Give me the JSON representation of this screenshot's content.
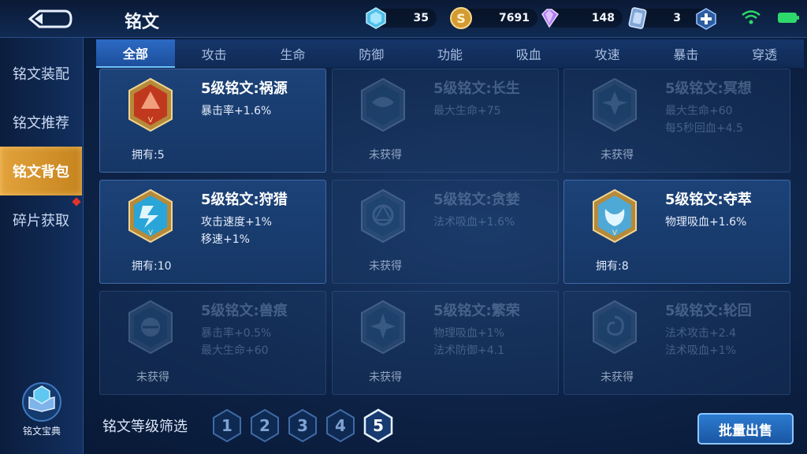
{
  "header": {
    "title": "铭文",
    "back_icon": "back-arrow-icon",
    "resources": [
      {
        "icon": "crystal-icon",
        "value": "35"
      },
      {
        "icon": "gold-coin-icon",
        "value": "7691"
      },
      {
        "icon": "purple-gem-icon",
        "value": "148"
      },
      {
        "icon": "card-ticket-icon",
        "value": "3"
      }
    ]
  },
  "sidebar": {
    "items": [
      {
        "label": "铭文装配"
      },
      {
        "label": "铭文推荐"
      },
      {
        "label": "铭文背包",
        "active": true
      },
      {
        "label": "碎片获取"
      }
    ],
    "codex_label": "铭文宝典"
  },
  "tabs": [
    "全部",
    "攻击",
    "生命",
    "防御",
    "功能",
    "吸血",
    "攻速",
    "暴击",
    "穿透"
  ],
  "cards": [
    {
      "name": "5级铭文:祸源",
      "attrs": [
        "暴击率+1.6%"
      ],
      "owned": "拥有:5",
      "locked": false,
      "color": "#c0391f"
    },
    {
      "name": "5级铭文:长生",
      "attrs": [
        "最大生命+75"
      ],
      "owned": "未获得",
      "locked": true,
      "color": "#2c5f8a"
    },
    {
      "name": "5级铭文:冥想",
      "attrs": [
        "最大生命+60",
        "每5秒回血+4.5"
      ],
      "owned": "未获得",
      "locked": true,
      "color": "#2c5f8a"
    },
    {
      "name": "5级铭文:狩猎",
      "attrs": [
        "攻击速度+1%",
        "移速+1%"
      ],
      "owned": "拥有:10",
      "locked": false,
      "color": "#2aa5d8"
    },
    {
      "name": "5级铭文:贪婪",
      "attrs": [
        "法术吸血+1.6%"
      ],
      "owned": "未获得",
      "locked": true,
      "color": "#2c5f8a"
    },
    {
      "name": "5级铭文:夺萃",
      "attrs": [
        "物理吸血+1.6%"
      ],
      "owned": "拥有:8",
      "locked": false,
      "color": "#4fa9d6"
    },
    {
      "name": "5级铭文:兽痕",
      "attrs": [
        "暴击率+0.5%",
        "最大生命+60"
      ],
      "owned": "未获得",
      "locked": true,
      "color": "#2c5f8a"
    },
    {
      "name": "5级铭文:繁荣",
      "attrs": [
        "物理吸血+1%",
        "法术防御+4.1"
      ],
      "owned": "未获得",
      "locked": true,
      "color": "#2c5f8a"
    },
    {
      "name": "5级铭文:轮回",
      "attrs": [
        "法术攻击+2.4",
        "法术吸血+1%"
      ],
      "owned": "未获得",
      "locked": true,
      "color": "#2c5f8a"
    }
  ],
  "footer": {
    "filter_label": "铭文等级筛选",
    "levels": [
      "1",
      "2",
      "3",
      "4",
      "5"
    ],
    "active_level": "5",
    "sell_label": "批量出售"
  },
  "colors": {
    "accent": "#e2a23b",
    "tab_active": "#2c6ac4",
    "wifi": "#2ed96b"
  }
}
